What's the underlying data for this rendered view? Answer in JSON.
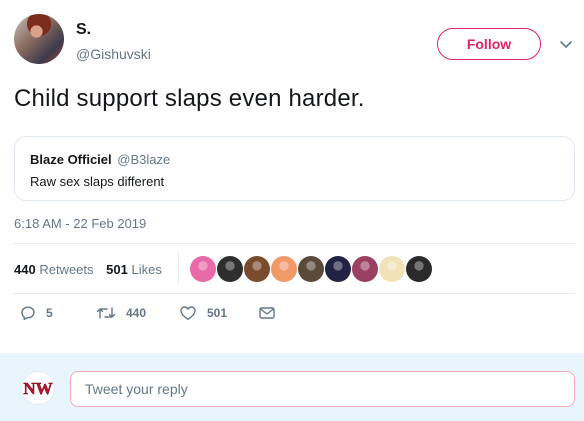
{
  "author": {
    "name": "S.",
    "handle": "@Gishuvski"
  },
  "follow_button": {
    "label": "Follow"
  },
  "tweet": {
    "text": "Child support slaps even harder.",
    "timestamp": "6:18 AM - 22 Feb 2019"
  },
  "quoted_tweet": {
    "name": "Blaze Officiel",
    "handle": "@B3laze",
    "text": "Raw sex slaps different"
  },
  "stats": {
    "retweets_count": "440",
    "retweets_label": "Retweets",
    "likes_count": "501",
    "likes_label": "Likes"
  },
  "likers": [
    {
      "name": "liker-avatar-1",
      "color": "#e86aa8"
    },
    {
      "name": "liker-avatar-2",
      "color": "#2e2e2e"
    },
    {
      "name": "liker-avatar-3",
      "color": "#7b4b2e"
    },
    {
      "name": "liker-avatar-4",
      "color": "#f09a6a"
    },
    {
      "name": "liker-avatar-5",
      "color": "#5a4a3a"
    },
    {
      "name": "liker-avatar-6",
      "color": "#222244"
    },
    {
      "name": "liker-avatar-7",
      "color": "#9a4060"
    },
    {
      "name": "liker-avatar-8",
      "color": "#f2e2b8"
    },
    {
      "name": "liker-avatar-9",
      "color": "#2a2a2a"
    }
  ],
  "actions": {
    "replies": "5",
    "retweets": "440",
    "likes": "501"
  },
  "reply_box": {
    "placeholder": "Tweet your reply",
    "avatar_text": "NW"
  },
  "colors": {
    "accent": "#e0245e",
    "muted": "#657786",
    "reply_bg": "#e8f5fd"
  }
}
